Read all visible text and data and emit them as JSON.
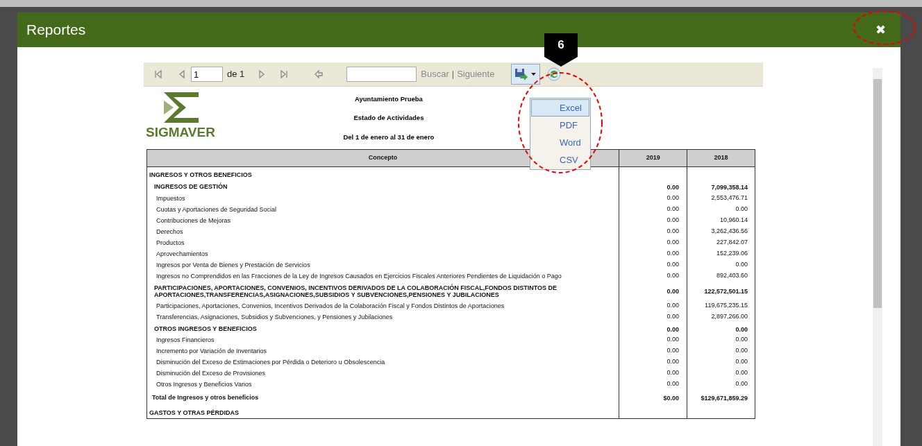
{
  "dialog": {
    "title": "Reportes",
    "close_icon": "✖"
  },
  "annotation": {
    "badge": "6"
  },
  "toolbar": {
    "page": "1",
    "of_label": "de 1",
    "find_label": "Buscar",
    "separator": "|",
    "next_label": "Siguiente"
  },
  "export_menu": {
    "items": [
      {
        "label": "Excel",
        "selected": true
      },
      {
        "label": "PDF",
        "selected": false
      },
      {
        "label": "Word",
        "selected": false
      },
      {
        "label": "CSV",
        "selected": false
      }
    ]
  },
  "report": {
    "logo_text": "SIGMAVER",
    "header_lines": [
      "Ayuntamiento Prueba",
      "Estado de Actividades",
      "Del 1 de enero al 31 de enero"
    ],
    "columns": [
      "Concepto",
      "2019",
      "2018"
    ],
    "rows": [
      {
        "kind": "section",
        "concept": "INGRESOS Y OTROS BENEFICIOS",
        "v2019": "",
        "v2018": ""
      },
      {
        "kind": "group",
        "concept": "INGRESOS DE GESTIÓN",
        "v2019": "0.00",
        "v2018": "7,099,358.14"
      },
      {
        "kind": "item",
        "concept": "Impuestos",
        "v2019": "0.00",
        "v2018": "2,553,476.71"
      },
      {
        "kind": "item",
        "concept": "Cuotas y Aportaciones de Seguridad Social",
        "v2019": "0.00",
        "v2018": "0.00"
      },
      {
        "kind": "item",
        "concept": "Contribuciones de Mejoras",
        "v2019": "0.00",
        "v2018": "10,960.14"
      },
      {
        "kind": "item",
        "concept": "Derechos",
        "v2019": "0.00",
        "v2018": "3,262,436.56"
      },
      {
        "kind": "item",
        "concept": "Productos",
        "v2019": "0.00",
        "v2018": "227,842.07"
      },
      {
        "kind": "item",
        "concept": "Aprovechamientos",
        "v2019": "0.00",
        "v2018": "152,239.06"
      },
      {
        "kind": "item",
        "concept": "Ingresos por Venta de Bienes y Prestación de Servicios",
        "v2019": "0.00",
        "v2018": "0.00"
      },
      {
        "kind": "item",
        "concept": "Ingresos no Comprendidos en las Fracciones de la Ley de Ingresos Causados en Ejercicios Fiscales Anteriores Pendientes de Liquidación o Pago",
        "v2019": "0.00",
        "v2018": "892,403.60"
      },
      {
        "kind": "group",
        "concept": "PARTICIPACIONES, APORTACIONES, CONVENIOS, INCENTIVOS DERIVADOS DE LA COLABORACIÓN FISCAL,FONDOS DISTINTOS DE APORTACIONES,TRANSFERENCIAS,ASIGNACIONES,SUBSIDIOS Y SUBVENCIONES,PENSIONES Y JUBILACIONES",
        "v2019": "0.00",
        "v2018": "122,572,501.15"
      },
      {
        "kind": "item",
        "concept": "Participaciones, Aportaciones, Convenios, Incentivos Derivados de la Colaboración Fiscal y Fondos Distintos de Aportaciones",
        "v2019": "0.00",
        "v2018": "119,675,235.15"
      },
      {
        "kind": "item",
        "concept": "Transferencias, Asignaciones, Subsidios y Subvenciones, y Pensiones y Jubilaciones",
        "v2019": "0.00",
        "v2018": "2,897,266.00"
      },
      {
        "kind": "group",
        "concept": "OTROS INGRESOS Y BENEFICIOS",
        "v2019": "0.00",
        "v2018": "0.00"
      },
      {
        "kind": "item",
        "concept": "Ingresos Financieros",
        "v2019": "0.00",
        "v2018": "0.00"
      },
      {
        "kind": "item",
        "concept": "Incremento por Variación de Inventarios",
        "v2019": "0.00",
        "v2018": "0.00"
      },
      {
        "kind": "item",
        "concept": "Disminución del Exceso de Estimaciones por Pérdida o Deterioro u Obsolescencia",
        "v2019": "0.00",
        "v2018": "0.00"
      },
      {
        "kind": "item",
        "concept": "Disminución del Exceso de Provisiones",
        "v2019": "0.00",
        "v2018": "0.00"
      },
      {
        "kind": "item",
        "concept": "Otros Ingresos y Beneficios Varios",
        "v2019": "0.00",
        "v2018": "0.00"
      },
      {
        "kind": "total",
        "concept": "Total de Ingresos y otros beneficios",
        "v2019": "$0.00",
        "v2018": "$129,671,859.29"
      },
      {
        "kind": "section",
        "concept": "GASTOS Y OTRAS PÉRDIDAS",
        "v2019": "",
        "v2018": ""
      }
    ]
  }
}
